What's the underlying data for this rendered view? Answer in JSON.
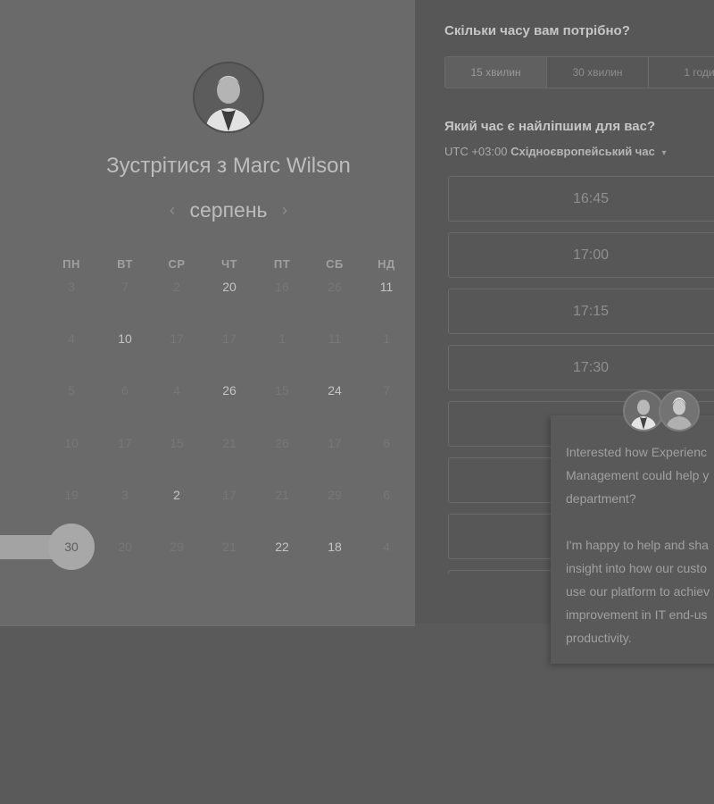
{
  "host": {
    "title_prefix": "Зустрітися з",
    "name": "Marc Wilson",
    "avatar_icon": "person-avatar-icon"
  },
  "calendar": {
    "prev_icon": "chevron-left-icon",
    "next_icon": "chevron-right-icon",
    "month_prev_glyph": "‹",
    "month_next_glyph": "›",
    "month": "серпень",
    "weekdays": [
      "ПН",
      "ВТ",
      "СР",
      "ЧТ",
      "ПТ",
      "СБ",
      "НД"
    ],
    "rows": [
      [
        {
          "d": "3",
          "s": "dim"
        },
        {
          "d": "7",
          "s": "dim"
        },
        {
          "d": "2",
          "s": "dim"
        },
        {
          "d": "20",
          "s": "avail"
        },
        {
          "d": "16",
          "s": "dim"
        },
        {
          "d": "26",
          "s": "dim"
        },
        {
          "d": "11",
          "s": "avail"
        }
      ],
      [
        {
          "d": "4",
          "s": "dim"
        },
        {
          "d": "10",
          "s": "avail"
        },
        {
          "d": "17",
          "s": "dim"
        },
        {
          "d": "17",
          "s": "dim"
        },
        {
          "d": "1",
          "s": "dim"
        },
        {
          "d": "11",
          "s": "dim"
        },
        {
          "d": "1",
          "s": "dim"
        }
      ],
      [
        {
          "d": "5",
          "s": "dim"
        },
        {
          "d": "6",
          "s": "dim"
        },
        {
          "d": "4",
          "s": "dim"
        },
        {
          "d": "26",
          "s": "avail"
        },
        {
          "d": "15",
          "s": "dim"
        },
        {
          "d": "24",
          "s": "avail"
        },
        {
          "d": "7",
          "s": "dim"
        }
      ],
      [
        {
          "d": "10",
          "s": "dim"
        },
        {
          "d": "17",
          "s": "dim"
        },
        {
          "d": "15",
          "s": "dim"
        },
        {
          "d": "21",
          "s": "dim"
        },
        {
          "d": "26",
          "s": "dim"
        },
        {
          "d": "17",
          "s": "dim"
        },
        {
          "d": "6",
          "s": "dim"
        }
      ],
      [
        {
          "d": "19",
          "s": "dim"
        },
        {
          "d": "3",
          "s": "dim"
        },
        {
          "d": "2",
          "s": "avail"
        },
        {
          "d": "17",
          "s": "dim"
        },
        {
          "d": "21",
          "s": "dim"
        },
        {
          "d": "29",
          "s": "dim"
        },
        {
          "d": "6",
          "s": "dim"
        }
      ],
      [
        {
          "d": "30",
          "s": "selected"
        },
        {
          "d": "20",
          "s": "dim"
        },
        {
          "d": "29",
          "s": "dim"
        },
        {
          "d": "21",
          "s": "dim"
        },
        {
          "d": "22",
          "s": "avail"
        },
        {
          "d": "18",
          "s": "avail"
        },
        {
          "d": "4",
          "s": "dim"
        }
      ]
    ]
  },
  "duration": {
    "question": "Скільки часу вам потрібно?",
    "options": [
      "15 хвилин",
      "30 хвилин",
      "1 годи"
    ],
    "selected": 0
  },
  "time": {
    "question": "Який час є найліпшим для вас?",
    "tz_offset": "UTC +03:00",
    "tz_name": "Східноєвропейський час",
    "tz_caret": "▾",
    "tz_caret_icon": "caret-down-icon",
    "slots": [
      "16:45",
      "17:00",
      "17:15",
      "17:30",
      "",
      "",
      "",
      ""
    ]
  },
  "chat": {
    "lines_p1": [
      "Interested how Experienc",
      "Management could help y",
      "department?"
    ],
    "lines_p2": [
      "I'm happy to help and sha",
      "insight into how our custo",
      "use our platform to achiev",
      "improvement in IT end-us",
      "productivity."
    ],
    "avatar_icons": [
      "person-avatar-icon",
      "person-avatar-icon"
    ]
  },
  "colors": {
    "background": "#5a5a5a",
    "left_panel": "#6a6a6a",
    "right_panel": "#575757",
    "selected_day": "#a8a8a8"
  }
}
